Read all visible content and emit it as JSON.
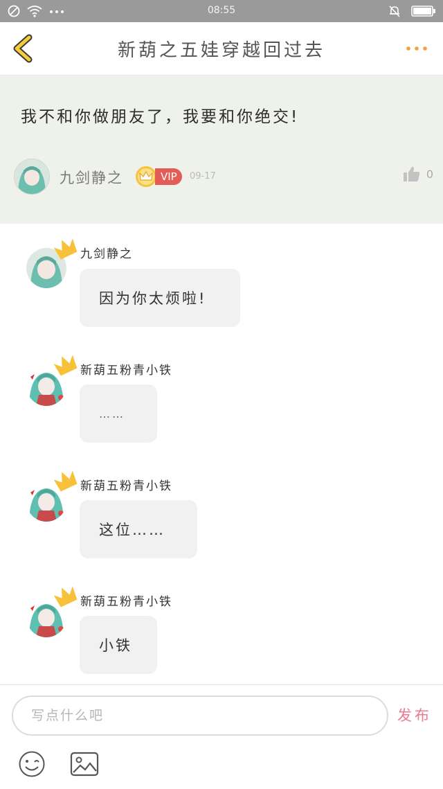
{
  "status_bar": {
    "time": "08:55",
    "icons": [
      "blocked-icon",
      "wifi-icon",
      "more-dots-icon",
      "bell-muted-icon",
      "battery-icon"
    ]
  },
  "header": {
    "title": "新葫之五娃穿越回过去",
    "back_icon": "chevron-left-icon",
    "more_icon": "more-dots-icon",
    "accent_color": "#f2a03d"
  },
  "post": {
    "content": "我不和你做朋友了，我要和你绝交!",
    "author": {
      "name": "九剑静之",
      "badge": "VIP",
      "date": "09-17"
    },
    "likes": "0"
  },
  "comments": [
    {
      "username": "九剑静之",
      "text": "因为你太烦啦!"
    },
    {
      "username": "新葫五粉青小铁",
      "text": "……"
    },
    {
      "username": "新葫五粉青小铁",
      "text": "这位……"
    },
    {
      "username": "新葫五粉青小铁",
      "text": "小铁"
    }
  ],
  "composer": {
    "placeholder": "写点什么吧",
    "publish_label": "发布",
    "publish_color": "#ec7a8f"
  },
  "colors": {
    "post_background": "#eff2ea",
    "vip_badge": "#e35d57",
    "crown": "#f7c23a",
    "bubble": "#f1f1f1"
  }
}
